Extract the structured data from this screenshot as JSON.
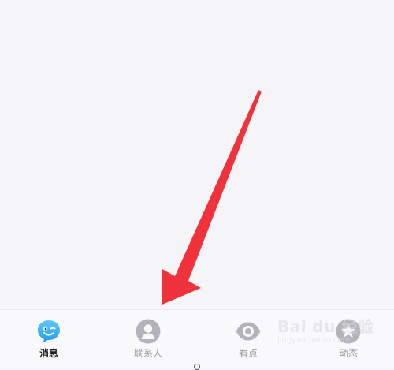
{
  "tab_bar": {
    "tabs": [
      {
        "label": "消息",
        "icon": "qq-penguin-icon",
        "active": true,
        "color": "#29a9f0"
      },
      {
        "label": "联系人",
        "icon": "contact-person-icon",
        "active": false,
        "color": "#b3b3bd"
      },
      {
        "label": "看点",
        "icon": "eye-icon",
        "active": false,
        "color": "#b3b3bd"
      },
      {
        "label": "动态",
        "icon": "star-icon",
        "active": false,
        "color": "#b3b3bd"
      }
    ]
  },
  "annotation": {
    "arrow_color": "#f0323c"
  },
  "watermark": {
    "text": "Bai du 经验",
    "sub": "jingyan.baidu.com"
  }
}
